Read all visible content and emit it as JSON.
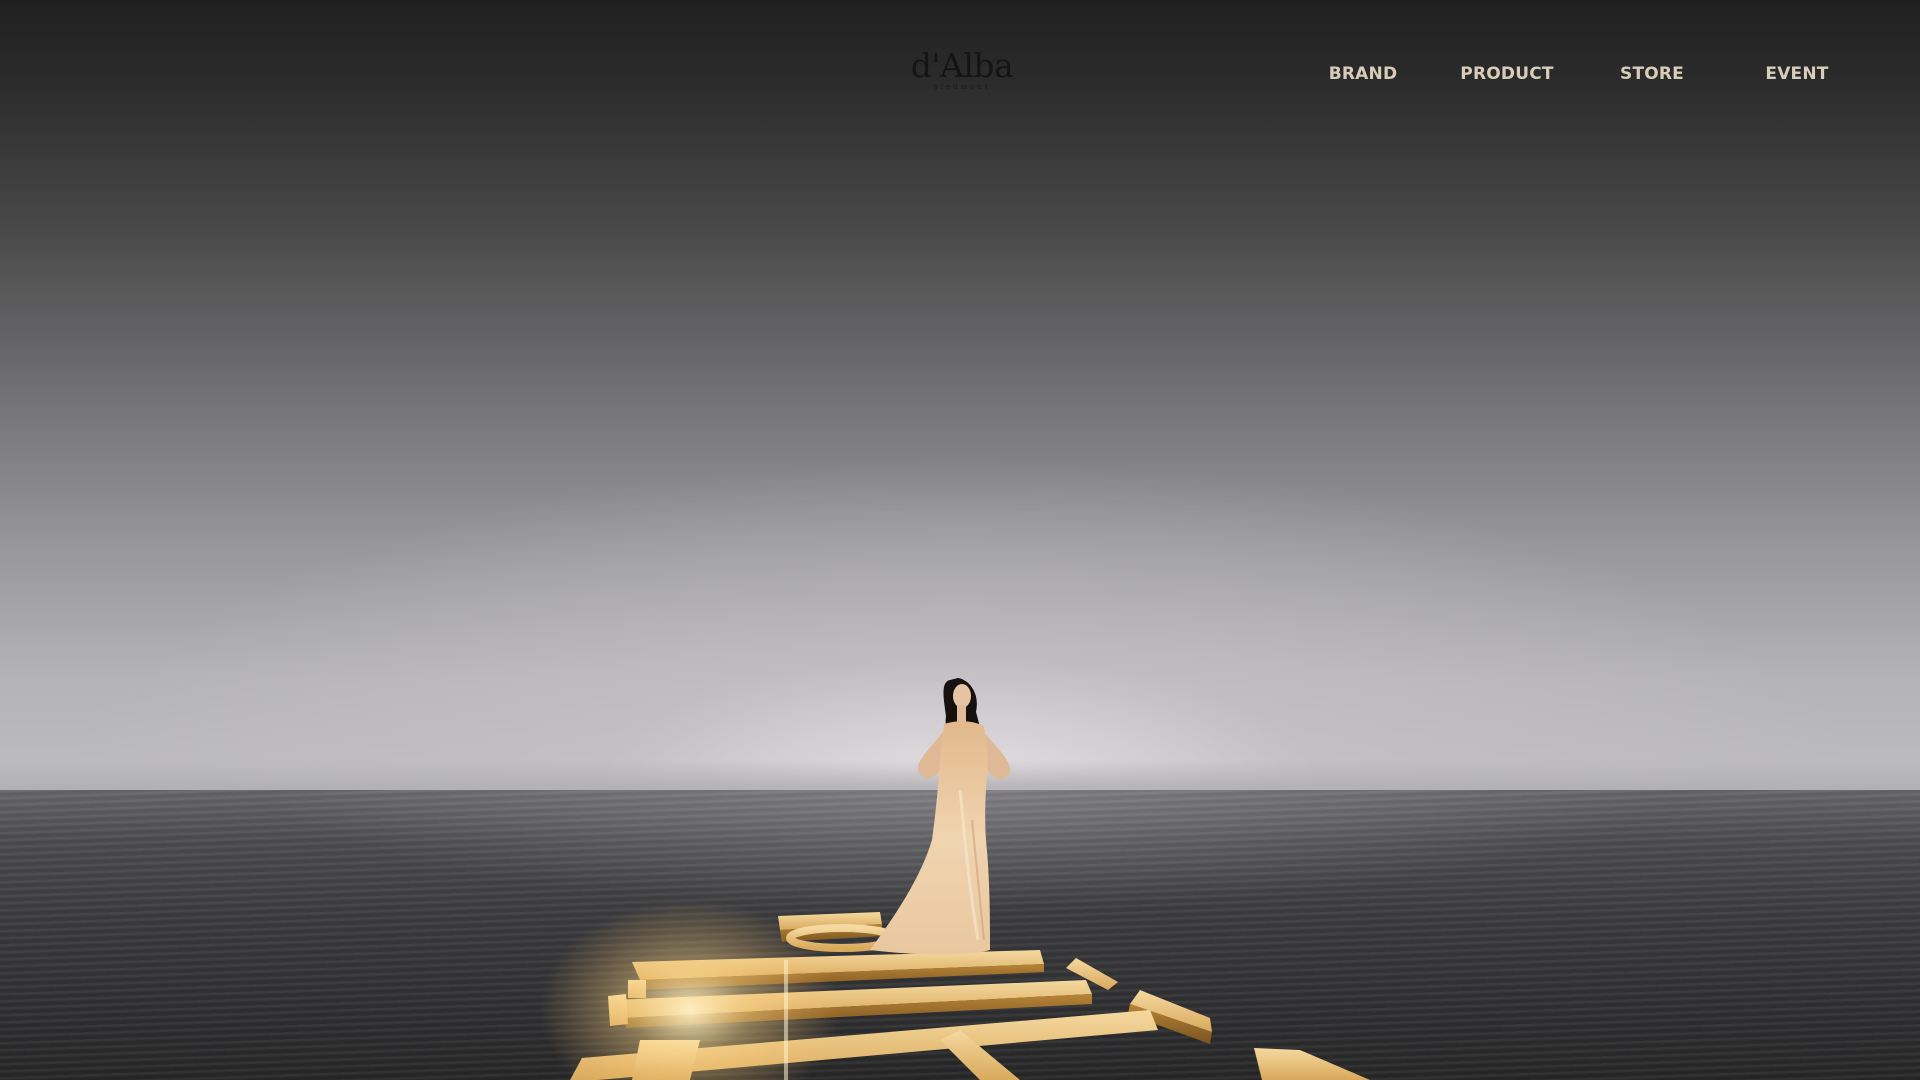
{
  "header": {
    "logo": {
      "text": "d'Alba",
      "subtext": "piedmont"
    },
    "nav": [
      {
        "label": "BRAND"
      },
      {
        "label": "PRODUCT"
      },
      {
        "label": "STORE"
      },
      {
        "label": "EVENT"
      }
    ]
  },
  "colors": {
    "nav_text": "#d7cdb8",
    "logo_text": "#141414",
    "gold": "#e7c283",
    "dress": "#ecd1ad"
  },
  "hero": {
    "image": "woman-in-gold-gown-on-golden-letters-over-sea"
  }
}
